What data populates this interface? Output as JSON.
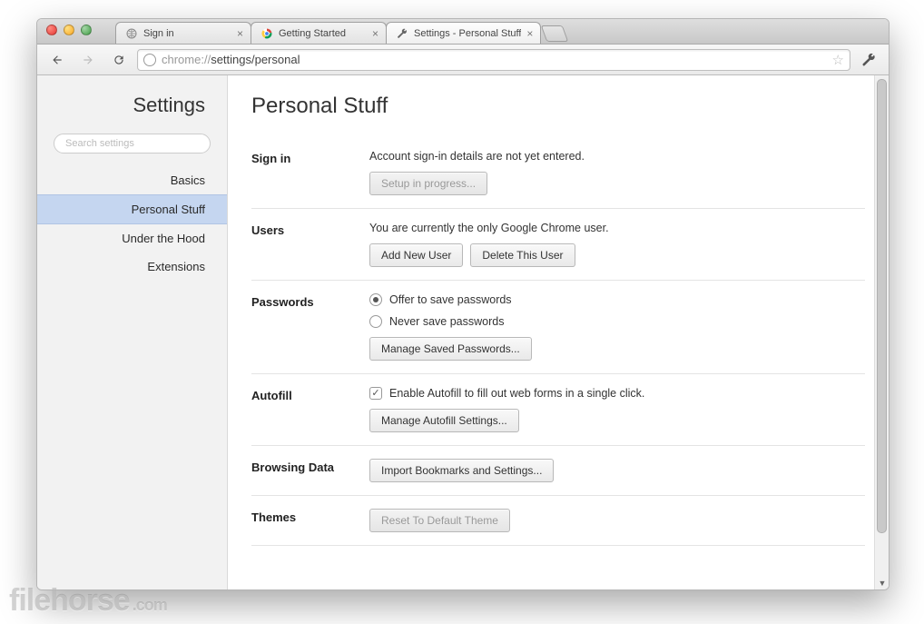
{
  "tabs": {
    "items": [
      {
        "label": "Sign in"
      },
      {
        "label": "Getting Started"
      },
      {
        "label": "Settings - Personal Stuff"
      }
    ]
  },
  "omnibox": {
    "scheme": "chrome://",
    "path": "settings/personal"
  },
  "sidebar": {
    "title": "Settings",
    "search_placeholder": "Search settings",
    "items": [
      {
        "label": "Basics"
      },
      {
        "label": "Personal Stuff"
      },
      {
        "label": "Under the Hood"
      },
      {
        "label": "Extensions"
      }
    ]
  },
  "page": {
    "title": "Personal Stuff",
    "signin": {
      "heading": "Sign in",
      "status": "Account sign-in details are not yet entered.",
      "setup_btn": "Setup in progress..."
    },
    "users": {
      "heading": "Users",
      "status": "You are currently the only Google Chrome user.",
      "add_btn": "Add New User",
      "delete_btn": "Delete This User"
    },
    "passwords": {
      "heading": "Passwords",
      "opt_offer": "Offer to save passwords",
      "opt_never": "Never save passwords",
      "manage_btn": "Manage Saved Passwords..."
    },
    "autofill": {
      "heading": "Autofill",
      "checkbox_label": "Enable Autofill to fill out web forms in a single click.",
      "manage_btn": "Manage Autofill Settings..."
    },
    "browsing": {
      "heading": "Browsing Data",
      "import_btn": "Import Bookmarks and Settings..."
    },
    "themes": {
      "heading": "Themes",
      "reset_btn": "Reset To Default Theme"
    }
  },
  "watermark": {
    "brand": "filehorse",
    "tld": ".com"
  }
}
